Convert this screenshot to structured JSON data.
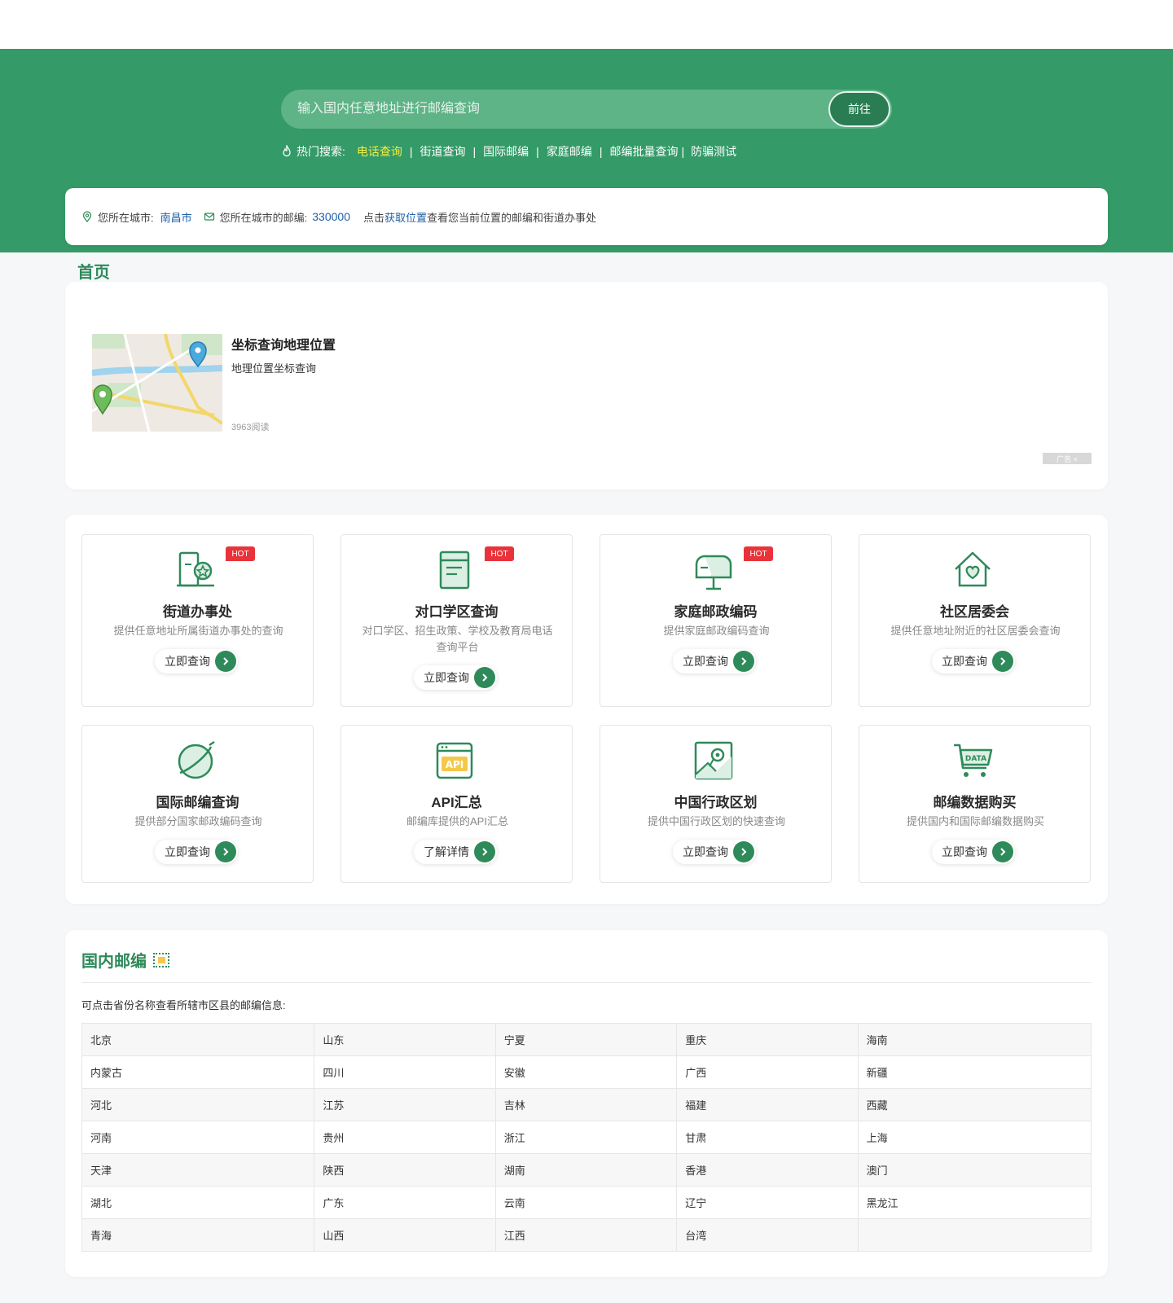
{
  "search": {
    "placeholder": "输入国内任意地址进行邮编查询",
    "button": "前往"
  },
  "hot": {
    "label": "热门搜索:",
    "links": [
      "电话查询",
      "街道查询",
      "国际邮编",
      "家庭邮编",
      "邮编批量查询",
      "防骗测试"
    ],
    "sep": "|"
  },
  "location": {
    "city_label": "您所在城市:",
    "city": "南昌市",
    "zip_label": "您所在城市的邮编:",
    "zip": "330000",
    "tip_pre": "点击",
    "tip_link": "获取位置",
    "tip_post": "查看您当前位置的邮编和街道办事处"
  },
  "breadcrumb": "首页",
  "ad": {
    "title": "坐标查询地理位置",
    "subtitle": "地理位置坐标查询",
    "reads": "3963阅读",
    "mark": "广告 ×"
  },
  "services": [
    {
      "title": "街道办事处",
      "desc": "提供任意地址所属街道办事处的查询",
      "button": "立即查询",
      "badge": "HOT",
      "icon": "building-badge-icon"
    },
    {
      "title": "对口学区查询",
      "desc": "对口学区、招生政策、学校及教育局电话查询平台",
      "button": "立即查询",
      "badge": "HOT",
      "icon": "document-icon"
    },
    {
      "title": "家庭邮政编码",
      "desc": "提供家庭邮政编码查询",
      "button": "立即查询",
      "badge": "HOT",
      "icon": "mailbox-icon"
    },
    {
      "title": "社区居委会",
      "desc": "提供任意地址附近的社区居委会查询",
      "button": "立即查询",
      "badge": "",
      "icon": "house-heart-icon"
    },
    {
      "title": "国际邮编查询",
      "desc": "提供部分国家邮政编码查询",
      "button": "立即查询",
      "badge": "",
      "icon": "globe-icon"
    },
    {
      "title": "API汇总",
      "desc": "邮编库提供的API汇总",
      "button": "了解详情",
      "badge": "",
      "icon": "api-icon"
    },
    {
      "title": "中国行政区划",
      "desc": "提供中国行政区划的快速查询",
      "button": "立即查询",
      "badge": "",
      "icon": "map-pin-icon"
    },
    {
      "title": "邮编数据购买",
      "desc": "提供国内和国际邮编数据购买",
      "button": "立即查询",
      "badge": "",
      "icon": "data-cart-icon"
    }
  ],
  "provinces": {
    "title": "国内邮编",
    "tip": "可点击省份名称查看所辖市区县的邮编信息:",
    "rows": [
      [
        "北京",
        "山东",
        "宁夏",
        "重庆",
        "海南"
      ],
      [
        "内蒙古",
        "四川",
        "安徽",
        "广西",
        "新疆"
      ],
      [
        "河北",
        "江苏",
        "吉林",
        "福建",
        "西藏"
      ],
      [
        "河南",
        "贵州",
        "浙江",
        "甘肃",
        "上海"
      ],
      [
        "天津",
        "陕西",
        "湖南",
        "香港",
        "澳门"
      ],
      [
        "湖北",
        "广东",
        "云南",
        "辽宁",
        "黑龙江"
      ],
      [
        "青海",
        "山西",
        "江西",
        "台湾",
        ""
      ]
    ]
  },
  "colors": {
    "primary": "#349a67",
    "dark": "#2f8a5a",
    "hot": "#e8333a",
    "highlight": "#f5ee40",
    "link": "#1f5fa8"
  }
}
